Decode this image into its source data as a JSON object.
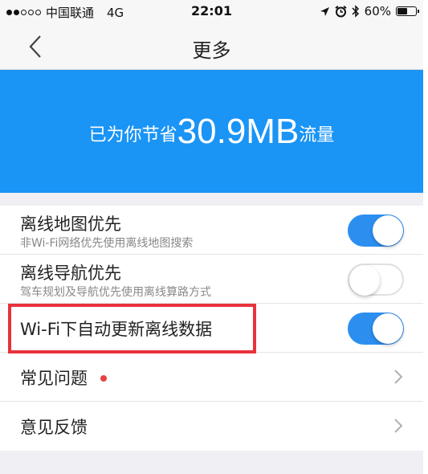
{
  "status_bar": {
    "signal_dots_filled": 2,
    "signal_dots_total": 5,
    "carrier": "中国联通",
    "network": "4G",
    "time": "22:01",
    "battery_text": "60%",
    "battery_level": 0.6,
    "icons": [
      "location-arrow-icon",
      "alarm-icon",
      "bluetooth-icon",
      "battery-icon"
    ]
  },
  "nav": {
    "back_icon": "chevron-left-icon",
    "title": "更多"
  },
  "banner": {
    "prefix": "已为你节省",
    "value": "30.9MB",
    "suffix": "流量",
    "color": "#1a94f5"
  },
  "settings": {
    "offline_map": {
      "title": "离线地图优先",
      "subtitle": "非Wi-Fi网络优先使用离线地图搜索",
      "enabled": true
    },
    "offline_nav": {
      "title": "离线导航优先",
      "subtitle": "驾车规划及导航优先使用离线算路方式",
      "enabled": false
    },
    "wifi_auto_update": {
      "title": "Wi-Fi下自动更新离线数据",
      "enabled": true
    },
    "faq": {
      "title": "常见问题",
      "has_badge": true
    },
    "feedback": {
      "title": "意见反馈"
    }
  },
  "colors": {
    "toggle_on": "#2c8ff0",
    "highlight": "#e8323c",
    "badge": "#e64340"
  }
}
